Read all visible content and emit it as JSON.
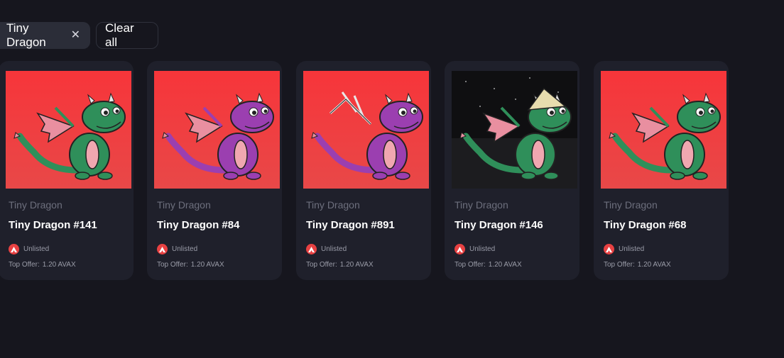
{
  "filters": {
    "active_filter": "Tiny Dragon",
    "clear_label": "Clear all"
  },
  "cards": [
    {
      "collection": "Tiny Dragon",
      "name": "Tiny Dragon #141",
      "status": "Unlisted",
      "offer_label": "Top Offer:",
      "offer_value": "1.20 AVAX",
      "body_color": "#2f8f5a",
      "bg": "red",
      "wing": "pink"
    },
    {
      "collection": "Tiny Dragon",
      "name": "Tiny Dragon #84",
      "status": "Unlisted",
      "offer_label": "Top Offer:",
      "offer_value": "1.20 AVAX",
      "body_color": "#9b3fb0",
      "bg": "red",
      "wing": "pink"
    },
    {
      "collection": "Tiny Dragon",
      "name": "Tiny Dragon #891",
      "status": "Unlisted",
      "offer_label": "Top Offer:",
      "offer_value": "1.20 AVAX",
      "body_color": "#9b3fb0",
      "bg": "red",
      "wing": "bone"
    },
    {
      "collection": "Tiny Dragon",
      "name": "Tiny Dragon #146",
      "status": "Unlisted",
      "offer_label": "Top Offer:",
      "offer_value": "1.20 AVAX",
      "body_color": "#2f8f5a",
      "bg": "space",
      "wing": "pink"
    },
    {
      "collection": "Tiny Dragon",
      "name": "Tiny Dragon #68",
      "status": "Unlisted",
      "offer_label": "Top Offer:",
      "offer_value": "1.20 AVAX",
      "body_color": "#2f8f5a",
      "bg": "red",
      "wing": "pink"
    }
  ],
  "colors": {
    "background": "#16161e",
    "card": "#1f202b",
    "avax": "#e84142",
    "red_bg": "#f23a3a"
  },
  "icons": {
    "close": "close-icon",
    "avax": "avax-icon"
  }
}
